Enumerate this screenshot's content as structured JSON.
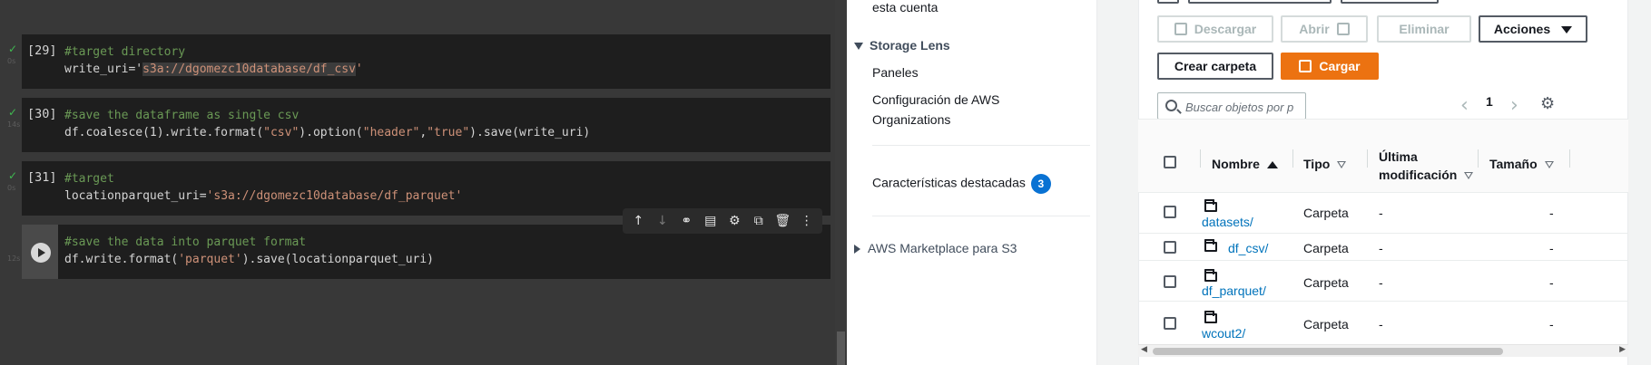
{
  "colab": {
    "cells": [
      {
        "num": "[29]",
        "time": "0s",
        "comment": "#target directory",
        "code_pre": "write_uri='",
        "code_sel": "s3a://dgomezc10database/df_csv",
        "code_post": "'"
      },
      {
        "num": "[30]",
        "time": "14s",
        "comment": "#save the dataframe as single csv",
        "code_a": "df.coalesce(1).write.format(",
        "code_s1": "\"csv\"",
        "code_b": ").option(",
        "code_s2": "\"header\"",
        "code_c": ",",
        "code_s3": "\"true\"",
        "code_d": ").save(write_uri)"
      },
      {
        "num": "[31]",
        "time": "0s",
        "comment": "#target",
        "code_pre": "locationparquet_uri=",
        "code_str": "'s3a://dgomezc10database/df_parquet'"
      },
      {
        "time": "12s",
        "comment": "#save the data into parquet format",
        "code_a": "df.write.format(",
        "code_str": "'parquet'",
        "code_b": ").save(locationparquet_uri)"
      }
    ],
    "toolbar_icons": [
      "arrow-up-icon",
      "arrow-down-icon",
      "link-icon",
      "comment-icon",
      "settings-icon",
      "mirror-cell-icon",
      "delete-icon",
      "more-icon"
    ]
  },
  "nav": {
    "account_text": "esta cuenta",
    "storage_lens": "Storage Lens",
    "paneles": "Paneles",
    "config_line1": "Configuración de AWS",
    "config_line2": "Organizations",
    "featured": "Características destacadas",
    "featured_count": "3",
    "marketplace": "AWS Marketplace para S3"
  },
  "s3": {
    "buttons": {
      "descargar": "Descargar",
      "abrir": "Abrir",
      "eliminar": "Eliminar",
      "acciones": "Acciones",
      "crear_carpeta": "Crear carpeta",
      "cargar": "Cargar"
    },
    "search_placeholder": "Buscar objetos por p",
    "page": "1",
    "columns": {
      "nombre": "Nombre",
      "tipo": "Tipo",
      "ultima_line1": "Última",
      "ultima_line2": "modificación",
      "tamano": "Tamaño"
    },
    "rows": [
      {
        "name": "datasets/",
        "type": "Carpeta",
        "modified": "-",
        "size": "-"
      },
      {
        "name": "df_csv/",
        "type": "Carpeta",
        "modified": "-",
        "size": "-"
      },
      {
        "name": "df_parquet/",
        "type": "Carpeta",
        "modified": "-",
        "size": "-"
      },
      {
        "name": "wcout2/",
        "type": "Carpeta",
        "modified": "-",
        "size": "-"
      }
    ]
  },
  "colors": {
    "colab_bg": "#383838",
    "cell_bg": "#1e1e1e",
    "aws_orange": "#ec7211",
    "aws_link": "#0073bb",
    "badge_blue": "#0972d3"
  }
}
